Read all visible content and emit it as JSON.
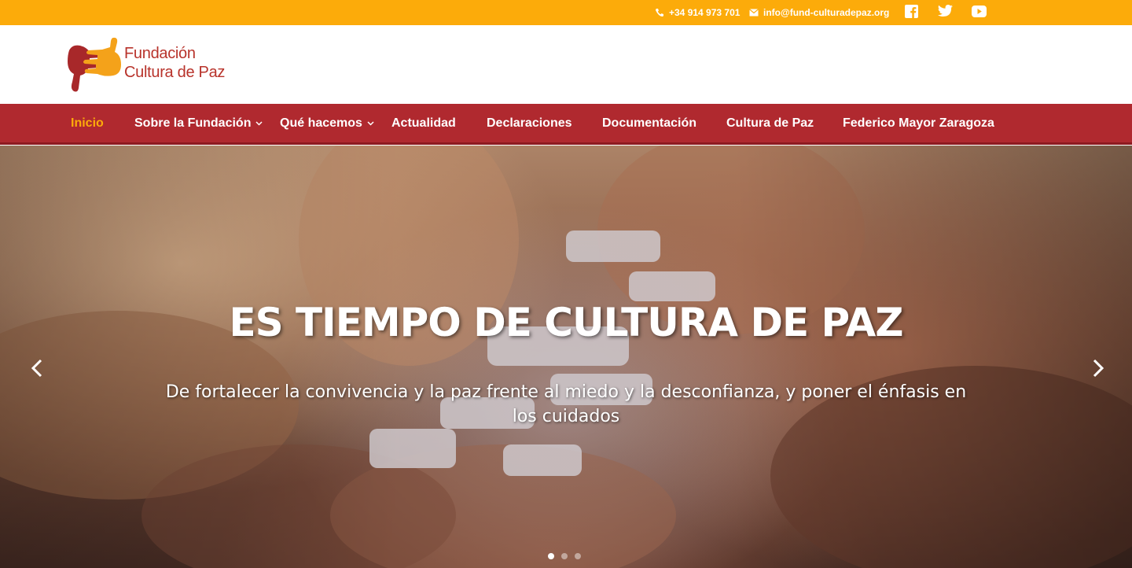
{
  "topbar": {
    "phone": "+34 914 973 701",
    "email": "info@fund-culturadepaz.org",
    "social": [
      {
        "icon": "facebook-icon"
      },
      {
        "icon": "twitter-icon"
      },
      {
        "icon": "youtube-icon"
      }
    ],
    "background": "#fcab0a"
  },
  "logo": {
    "line1": "Fundación",
    "line2": "Cultura de Paz"
  },
  "nav": {
    "items": [
      {
        "label": "Inicio",
        "active": true
      },
      {
        "label": "Sobre la Fundación",
        "dropdown": true
      },
      {
        "label": "Qué hacemos",
        "dropdown": true
      },
      {
        "label": "Actualidad"
      },
      {
        "label": "Declaraciones"
      },
      {
        "label": "Documentación"
      },
      {
        "label": "Cultura de Paz"
      },
      {
        "label": "Federico Mayor Zaragoza"
      }
    ],
    "background": "#b0292f",
    "active_color": "#fcab0a"
  },
  "hero": {
    "title": "ES TIEMPO DE CULTURA DE PAZ",
    "subtitle": "De fortalecer la convivencia y la paz frente al miedo y la desconfianza, y poner el énfasis en los cuidados",
    "slides": 3,
    "active_slide": 1
  }
}
